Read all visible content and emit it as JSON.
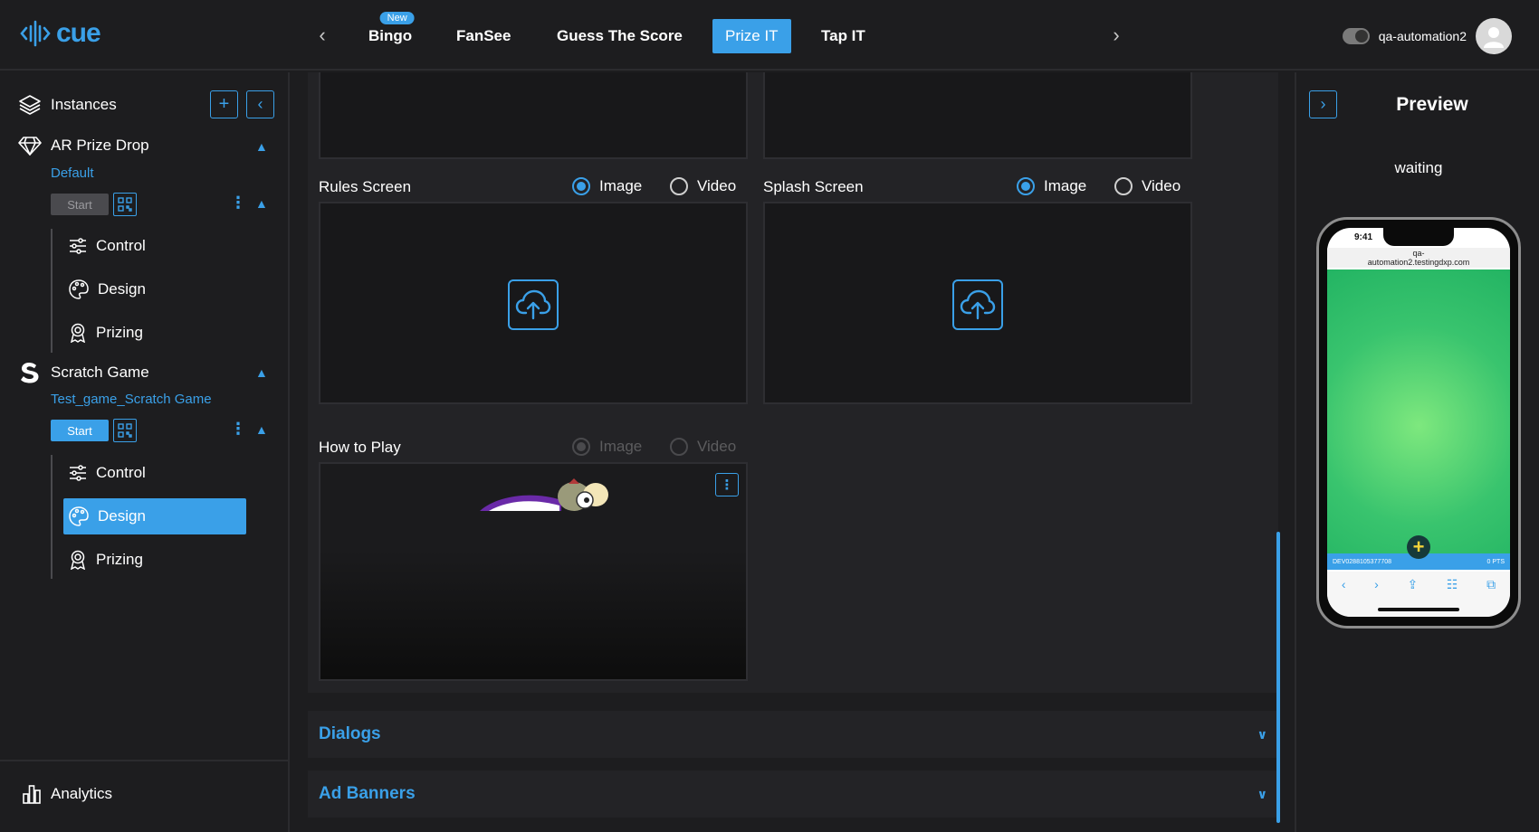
{
  "brand": {
    "logo_text": "cue"
  },
  "topnav": {
    "tabs": [
      {
        "label": "Bingo",
        "badge": "New"
      },
      {
        "label": "FanSee"
      },
      {
        "label": "Guess The Score"
      },
      {
        "label": "Prize IT",
        "active": true
      },
      {
        "label": "Tap IT"
      }
    ],
    "user_name": "qa-automation2"
  },
  "sidebar": {
    "instances_label": "Instances",
    "games": [
      {
        "name": "AR Prize Drop",
        "instance": "Default",
        "start_label": "Start",
        "items": [
          "Control",
          "Design",
          "Prizing"
        ]
      },
      {
        "name": "Scratch Game",
        "instance": "Test_game_Scratch Game",
        "start_label": "Start",
        "items": [
          "Control",
          "Design",
          "Prizing"
        ],
        "active_item": "Design"
      }
    ],
    "analytics_label": "Analytics"
  },
  "main": {
    "rules_screen": {
      "label": "Rules Screen",
      "image": "Image",
      "video": "Video",
      "selected": "Image"
    },
    "splash_screen": {
      "label": "Splash Screen",
      "image": "Image",
      "video": "Video",
      "selected": "Image"
    },
    "how_to_play": {
      "label": "How to Play",
      "image": "Image",
      "video": "Video",
      "selected": "Image"
    },
    "accordions": [
      "Dialogs",
      "Ad Banners"
    ]
  },
  "preview": {
    "title": "Preview",
    "status": "waiting",
    "phone": {
      "time": "9:41",
      "url_line1": "qa-",
      "url_line2": "automation2.testingdxp.com",
      "bar_left": "DEV0288105377708",
      "bar_right": "0 PTS"
    }
  },
  "colors": {
    "accent": "#3aa0e8",
    "background": "#1d1d1f",
    "panel": "#232326"
  }
}
